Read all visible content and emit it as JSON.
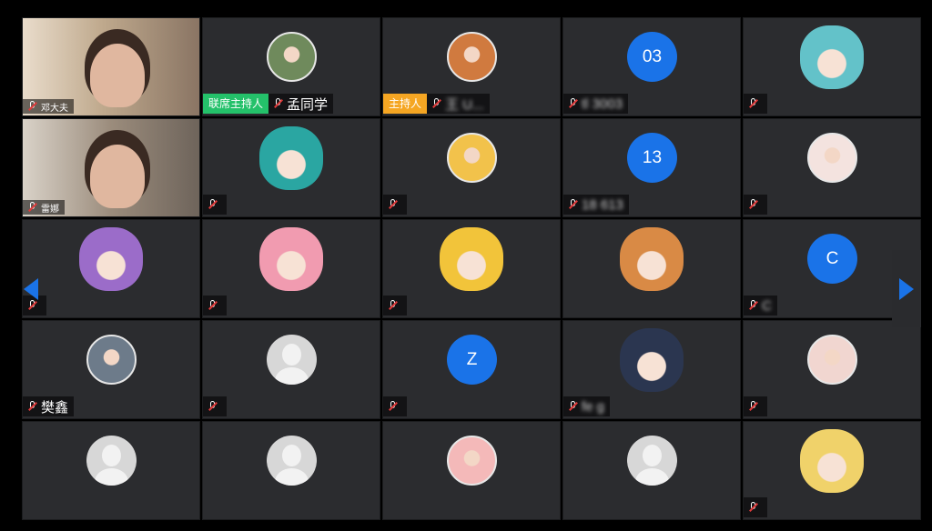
{
  "accent_color": "#1a73e8",
  "tiles": [
    {
      "type": "video",
      "name": "邓大夫",
      "small": true
    },
    {
      "type": "photo",
      "name": "孟同学",
      "badge": "联席主持人",
      "badge_kind": "cohost",
      "avatar_color": "#6f8a5c"
    },
    {
      "type": "photo",
      "name": "王 U...",
      "badge": "主持人",
      "badge_kind": "host",
      "blurred": true,
      "avatar_color": "#d07a3f"
    },
    {
      "type": "initials",
      "initials": "03",
      "name": "tl 3003",
      "blurred": true
    },
    {
      "type": "anime",
      "name": "",
      "avatar_color": "#63c2c9"
    },
    {
      "type": "video",
      "name": "雷娜",
      "small": true
    },
    {
      "type": "anime",
      "name": "",
      "avatar_color": "#2aa6a2"
    },
    {
      "type": "photo",
      "name": "",
      "avatar_color": "#f2c24b"
    },
    {
      "type": "initials",
      "initials": "13",
      "name": "18 613",
      "blurred": true
    },
    {
      "type": "photo",
      "name": "",
      "avatar_color": "#f4e3df"
    },
    {
      "type": "anime",
      "name": "",
      "avatar_color": "#9b6cc9"
    },
    {
      "type": "anime",
      "name": "",
      "avatar_color": "#f19bb0"
    },
    {
      "type": "anime",
      "name": "",
      "avatar_color": "#f2c43a"
    },
    {
      "type": "anime",
      "name": "",
      "avatar_color": "#d98a45",
      "no_mic": true
    },
    {
      "type": "initials",
      "initials": "C",
      "name": "C",
      "blurred": true
    },
    {
      "type": "photo",
      "name": "樊鑫",
      "avatar_color": "#6d7b8a"
    },
    {
      "type": "placeholder",
      "name": ""
    },
    {
      "type": "initials",
      "initials": "Z",
      "name": ""
    },
    {
      "type": "anime",
      "name": "fe g",
      "blurred": true,
      "avatar_color": "#2b3650"
    },
    {
      "type": "photo",
      "name": "",
      "avatar_color": "#f1d6d0"
    },
    {
      "type": "placeholder",
      "name": "",
      "no_mic": true
    },
    {
      "type": "placeholder",
      "name": "",
      "no_mic": true
    },
    {
      "type": "photo",
      "name": "",
      "avatar_color": "#f4b9b9",
      "no_mic": true
    },
    {
      "type": "placeholder",
      "name": "",
      "no_mic": true
    },
    {
      "type": "anime",
      "name": "",
      "avatar_color": "#f0d26a"
    }
  ]
}
